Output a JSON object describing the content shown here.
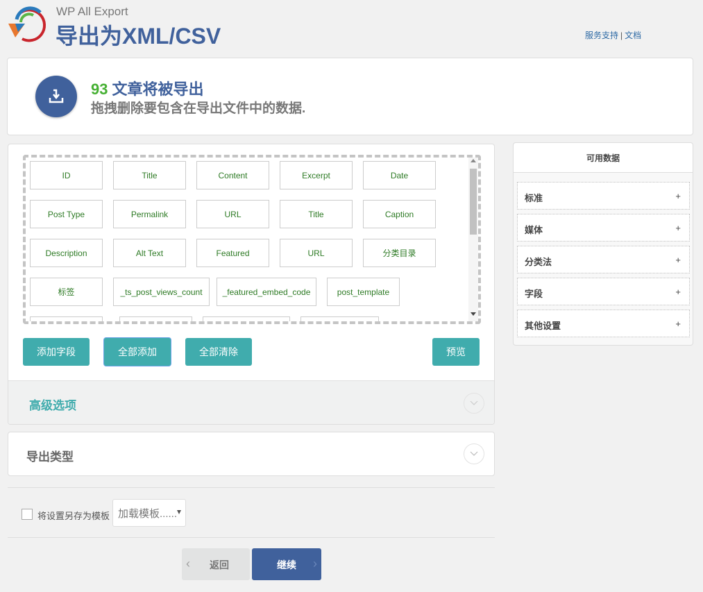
{
  "header": {
    "brand": "WP All Export",
    "title": "导出为XML/CSV",
    "links": [
      {
        "label": "服务支持"
      },
      {
        "label": "文档"
      }
    ],
    "link_separator": "|"
  },
  "summary": {
    "count": "93",
    "headline": "文章将被导出",
    "subtext": "拖拽删除要包含在导出文件中的数据."
  },
  "fields": [
    {
      "label": "ID"
    },
    {
      "label": "Title"
    },
    {
      "label": "Content"
    },
    {
      "label": "Excerpt"
    },
    {
      "label": "Date"
    },
    {
      "label": "Post Type"
    },
    {
      "label": "Permalink"
    },
    {
      "label": "URL"
    },
    {
      "label": "Title"
    },
    {
      "label": "Caption"
    },
    {
      "label": "Description"
    },
    {
      "label": "Alt Text"
    },
    {
      "label": "Featured"
    },
    {
      "label": "URL"
    },
    {
      "label": "分类目录"
    },
    {
      "label": "标签"
    },
    {
      "label": "_ts_post_views_count"
    },
    {
      "label": "_featured_embed_code"
    },
    {
      "label": "post_template"
    }
  ],
  "buttons": {
    "add_field": "添加字段",
    "add_all": "全部添加",
    "clear_all": "全部清除",
    "preview": "预览",
    "back": "返回",
    "continue": "继续"
  },
  "sections": {
    "advanced": "高级选项",
    "export_type": "导出类型"
  },
  "template": {
    "save_label": "将设置另存为模板",
    "save_checked": false,
    "load_placeholder": "加载模板......"
  },
  "sidebar": {
    "title": "可用数据",
    "items": [
      {
        "label": "标准",
        "icon": "+"
      },
      {
        "label": "媒体",
        "icon": "+"
      },
      {
        "label": "分类法",
        "icon": "+"
      },
      {
        "label": "字段",
        "icon": "+"
      },
      {
        "label": "其他设置",
        "icon": "+"
      }
    ]
  },
  "colors": {
    "brand_blue": "#40619c",
    "teal": "#40acad",
    "count_green": "#46b033",
    "field_text_green": "#2d7a24"
  }
}
